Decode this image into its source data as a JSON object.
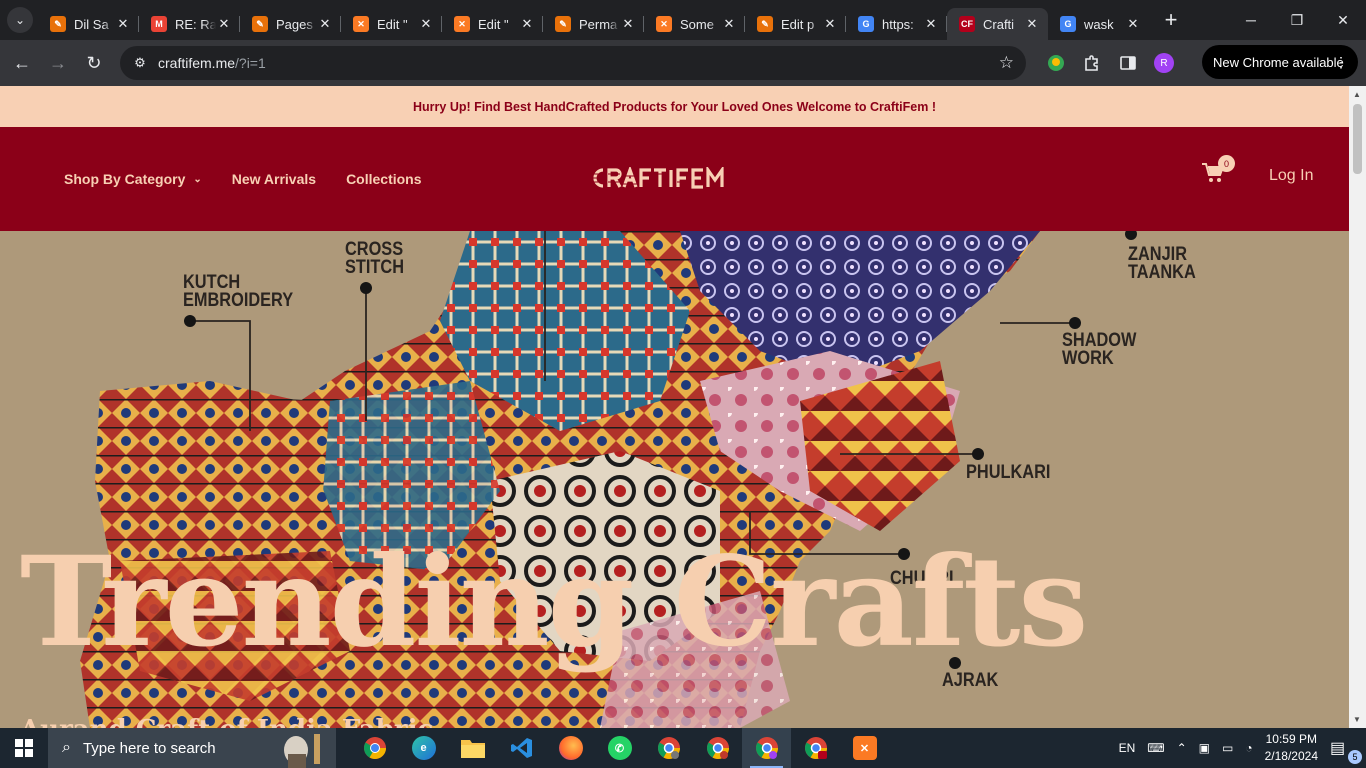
{
  "browser": {
    "tabs": [
      {
        "title": "Dil Sa",
        "favicon": "blogger-icon",
        "color": "#e8710a",
        "glyph": "✎",
        "active": false
      },
      {
        "title": "RE: Ra",
        "favicon": "gmail-icon",
        "color": "#ea4335",
        "glyph": "M",
        "active": false
      },
      {
        "title": "Pages",
        "favicon": "blogger-icon",
        "color": "#e8710a",
        "glyph": "✎",
        "active": false
      },
      {
        "title": "Edit \"",
        "favicon": "xampp-icon",
        "color": "#fb7a24",
        "glyph": "✕",
        "active": false
      },
      {
        "title": "Edit \"",
        "favicon": "xampp-icon",
        "color": "#fb7a24",
        "glyph": "✕",
        "active": false
      },
      {
        "title": "Perma",
        "favicon": "blogger-icon",
        "color": "#e8710a",
        "glyph": "✎",
        "active": false
      },
      {
        "title": "Some",
        "favicon": "xampp-icon",
        "color": "#fb7a24",
        "glyph": "✕",
        "active": false
      },
      {
        "title": "Edit p",
        "favicon": "blogger-icon",
        "color": "#e8710a",
        "glyph": "✎",
        "active": false
      },
      {
        "title": "https:",
        "favicon": "google-icon",
        "color": "#4285f4",
        "glyph": "G",
        "active": false
      },
      {
        "title": "Crafti",
        "favicon": "craftifem-icon",
        "color": "#b3001b",
        "glyph": "CF",
        "active": true
      },
      {
        "title": "wask",
        "favicon": "google-icon",
        "color": "#4285f4",
        "glyph": "G",
        "active": false
      }
    ],
    "url_host": "craftifem.me",
    "url_path": "/?i=1",
    "update_label": "New Chrome available",
    "profile_initial": "R"
  },
  "site": {
    "announcement": "Hurry Up! Find Best HandCrafted Products for Your Loved Ones Welcome to CraftiFem !",
    "nav": {
      "shop_by_category": "Shop By Category",
      "new_arrivals": "New Arrivals",
      "collections": "Collections"
    },
    "logo_text": "CRAFTIFEM",
    "cart_count": "0",
    "login_label": "Log In",
    "hero": {
      "title": "Trending Crafts",
      "subtitle": "Aurand Craft of India Fabric",
      "labels": {
        "cross_stitch": "CROSS\nSTITCH",
        "kutch_embroidery": "KUTCH\nEMBROIDERY",
        "zanjir_taanka": "ZANJIR\nTAANKA",
        "shadow_work": "SHADOW\nWORK",
        "phulkari": "PHULKARI",
        "chunri": "CHUNRI",
        "ajrak": "AJRAK"
      }
    }
  },
  "taskbar": {
    "search_placeholder": "Type here to search",
    "language": "EN",
    "time": "10:59 PM",
    "date": "2/18/2024",
    "notification_count": "5"
  },
  "colors": {
    "brand_maroon": "#8b0018",
    "brand_peach": "#f8d0b4"
  }
}
